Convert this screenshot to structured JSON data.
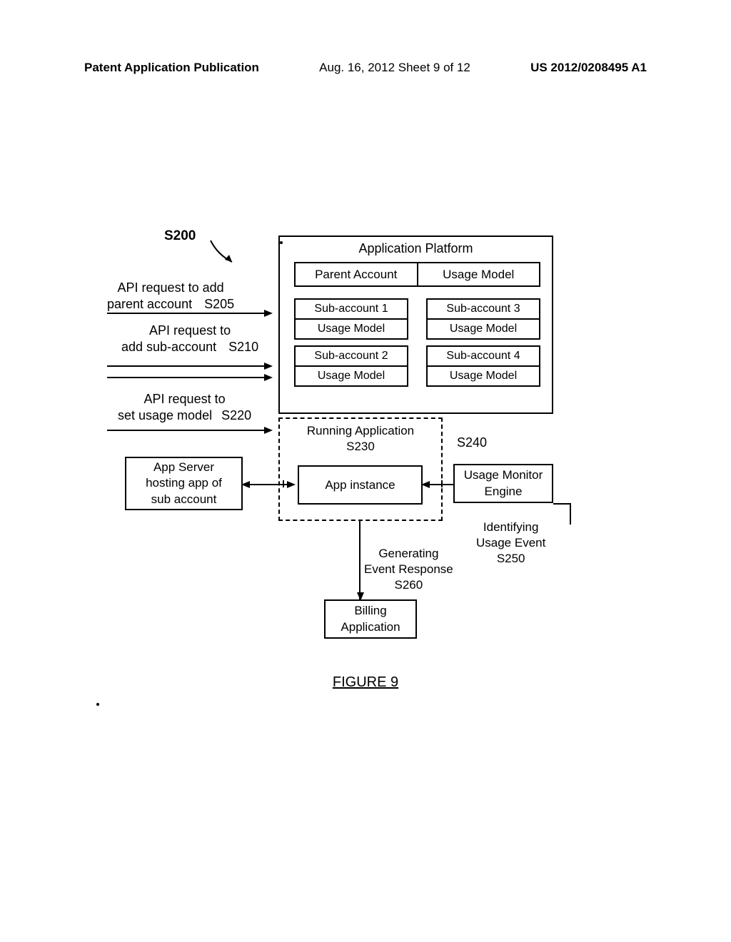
{
  "header": {
    "left": "Patent Application Publication",
    "center": "Aug. 16, 2012  Sheet 9 of 12",
    "right": "US 2012/0208495 A1"
  },
  "labels": {
    "s200": "S200",
    "api_req_1_l1": "API request to add",
    "api_req_1_l2": "parent account",
    "s205": "S205",
    "api_req_2_l1": "API request to",
    "api_req_2_l2": "add sub-account",
    "s210": "S210",
    "api_req_3_l1": "API request to",
    "api_req_3_l2": "set usage model",
    "s220": "S220",
    "platform_title": "Application Platform",
    "parent_account": "Parent Account",
    "usage_model": "Usage Model",
    "sub1": "Sub-account 1",
    "sub2": "Sub-account 2",
    "sub3": "Sub-account 3",
    "sub4": "Sub-account 4",
    "running_app_l1": "Running Application",
    "s230": "S230",
    "app_instance": "App instance",
    "s240": "S240",
    "usage_monitor_l1": "Usage Monitor",
    "usage_monitor_l2": "Engine",
    "app_server_l1": "App Server",
    "app_server_l2": "hosting app of",
    "app_server_l3": "sub account",
    "identifying_l1": "Identifying",
    "identifying_l2": "Usage Event",
    "s250": "S250",
    "generating_l1": "Generating",
    "generating_l2": "Event Response",
    "s260": "S260",
    "billing_l1": "Billing",
    "billing_l2": "Application",
    "figure": "FIGURE 9"
  }
}
